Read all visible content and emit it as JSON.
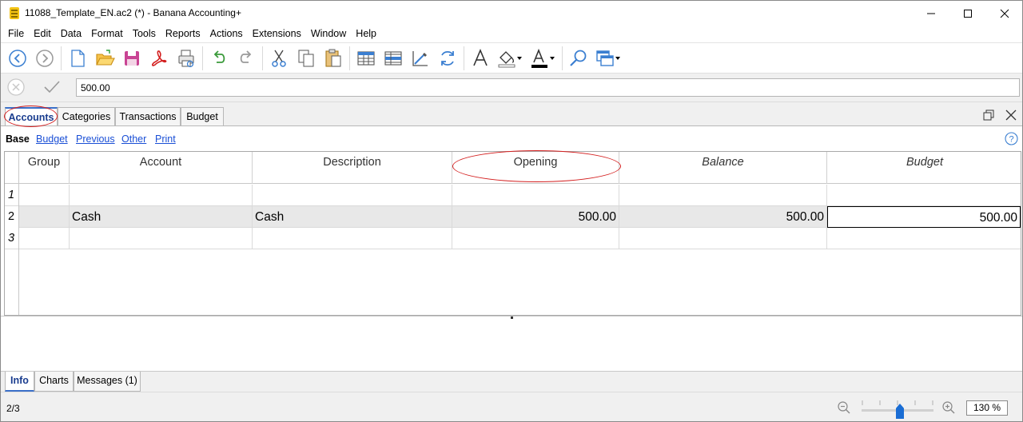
{
  "window": {
    "title": "11088_Template_EN.ac2 (*) - Banana Accounting+"
  },
  "menu": [
    "File",
    "Edit",
    "Data",
    "Format",
    "Tools",
    "Reports",
    "Actions",
    "Extensions",
    "Window",
    "Help"
  ],
  "toolbar": {
    "icons": [
      "back-icon",
      "forward-icon",
      "new-file-icon",
      "open-folder-icon",
      "save-icon",
      "pdf-icon",
      "print-preview-icon",
      "undo-icon",
      "redo-icon",
      "cut-icon",
      "copy-icon",
      "paste-icon",
      "insert-rows-icon",
      "add-row-icon",
      "edit-columns-icon",
      "recalculate-icon",
      "font-icon",
      "fill-color-icon",
      "text-color-icon",
      "search-icon",
      "windows-icon"
    ]
  },
  "edit_bar": {
    "value": "500.00"
  },
  "table_tabs": [
    "Accounts",
    "Categories",
    "Transactions",
    "Budget"
  ],
  "views": [
    "Base",
    "Budget",
    "Previous",
    "Other",
    "Print"
  ],
  "grid": {
    "columns": [
      "Group",
      "Account",
      "Description",
      "Opening",
      "Balance",
      "Budget"
    ],
    "rows": [
      {
        "num": "1",
        "group": "",
        "account": "",
        "description": "",
        "opening": "",
        "balance": "",
        "budget": ""
      },
      {
        "num": "2",
        "group": "",
        "account": "Cash",
        "description": "Cash",
        "opening": "500.00",
        "balance": "500.00",
        "budget": "500.00"
      },
      {
        "num": "3",
        "group": "",
        "account": "",
        "description": "",
        "opening": "",
        "balance": "",
        "budget": ""
      }
    ]
  },
  "bottom_tabs": [
    "Info",
    "Charts",
    "Messages (1)"
  ],
  "status": {
    "row_position": "2/3",
    "zoom": "130 %"
  },
  "colors": {
    "accent": "#1a3d8f",
    "link": "#1a4fd6",
    "annotation": "#d42020"
  }
}
